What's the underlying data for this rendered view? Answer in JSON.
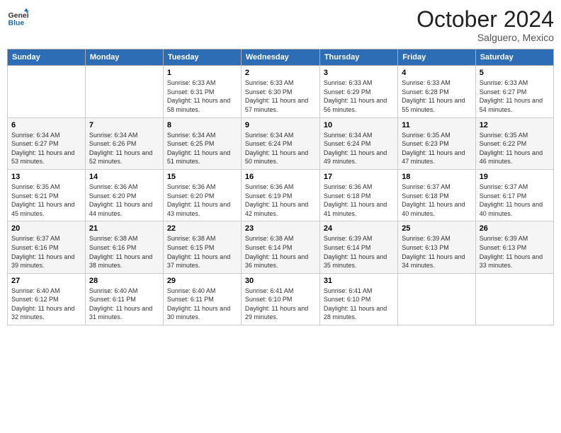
{
  "logo": {
    "line1": "General",
    "line2": "Blue"
  },
  "header": {
    "month": "October 2024",
    "location": "Salguero, Mexico"
  },
  "weekdays": [
    "Sunday",
    "Monday",
    "Tuesday",
    "Wednesday",
    "Thursday",
    "Friday",
    "Saturday"
  ],
  "weeks": [
    [
      {
        "day": "",
        "sunrise": "",
        "sunset": "",
        "daylight": ""
      },
      {
        "day": "",
        "sunrise": "",
        "sunset": "",
        "daylight": ""
      },
      {
        "day": "1",
        "sunrise": "Sunrise: 6:33 AM",
        "sunset": "Sunset: 6:31 PM",
        "daylight": "Daylight: 11 hours and 58 minutes."
      },
      {
        "day": "2",
        "sunrise": "Sunrise: 6:33 AM",
        "sunset": "Sunset: 6:30 PM",
        "daylight": "Daylight: 11 hours and 57 minutes."
      },
      {
        "day": "3",
        "sunrise": "Sunrise: 6:33 AM",
        "sunset": "Sunset: 6:29 PM",
        "daylight": "Daylight: 11 hours and 56 minutes."
      },
      {
        "day": "4",
        "sunrise": "Sunrise: 6:33 AM",
        "sunset": "Sunset: 6:28 PM",
        "daylight": "Daylight: 11 hours and 55 minutes."
      },
      {
        "day": "5",
        "sunrise": "Sunrise: 6:33 AM",
        "sunset": "Sunset: 6:27 PM",
        "daylight": "Daylight: 11 hours and 54 minutes."
      }
    ],
    [
      {
        "day": "6",
        "sunrise": "Sunrise: 6:34 AM",
        "sunset": "Sunset: 6:27 PM",
        "daylight": "Daylight: 11 hours and 53 minutes."
      },
      {
        "day": "7",
        "sunrise": "Sunrise: 6:34 AM",
        "sunset": "Sunset: 6:26 PM",
        "daylight": "Daylight: 11 hours and 52 minutes."
      },
      {
        "day": "8",
        "sunrise": "Sunrise: 6:34 AM",
        "sunset": "Sunset: 6:25 PM",
        "daylight": "Daylight: 11 hours and 51 minutes."
      },
      {
        "day": "9",
        "sunrise": "Sunrise: 6:34 AM",
        "sunset": "Sunset: 6:24 PM",
        "daylight": "Daylight: 11 hours and 50 minutes."
      },
      {
        "day": "10",
        "sunrise": "Sunrise: 6:34 AM",
        "sunset": "Sunset: 6:24 PM",
        "daylight": "Daylight: 11 hours and 49 minutes."
      },
      {
        "day": "11",
        "sunrise": "Sunrise: 6:35 AM",
        "sunset": "Sunset: 6:23 PM",
        "daylight": "Daylight: 11 hours and 47 minutes."
      },
      {
        "day": "12",
        "sunrise": "Sunrise: 6:35 AM",
        "sunset": "Sunset: 6:22 PM",
        "daylight": "Daylight: 11 hours and 46 minutes."
      }
    ],
    [
      {
        "day": "13",
        "sunrise": "Sunrise: 6:35 AM",
        "sunset": "Sunset: 6:21 PM",
        "daylight": "Daylight: 11 hours and 45 minutes."
      },
      {
        "day": "14",
        "sunrise": "Sunrise: 6:36 AM",
        "sunset": "Sunset: 6:20 PM",
        "daylight": "Daylight: 11 hours and 44 minutes."
      },
      {
        "day": "15",
        "sunrise": "Sunrise: 6:36 AM",
        "sunset": "Sunset: 6:20 PM",
        "daylight": "Daylight: 11 hours and 43 minutes."
      },
      {
        "day": "16",
        "sunrise": "Sunrise: 6:36 AM",
        "sunset": "Sunset: 6:19 PM",
        "daylight": "Daylight: 11 hours and 42 minutes."
      },
      {
        "day": "17",
        "sunrise": "Sunrise: 6:36 AM",
        "sunset": "Sunset: 6:18 PM",
        "daylight": "Daylight: 11 hours and 41 minutes."
      },
      {
        "day": "18",
        "sunrise": "Sunrise: 6:37 AM",
        "sunset": "Sunset: 6:18 PM",
        "daylight": "Daylight: 11 hours and 40 minutes."
      },
      {
        "day": "19",
        "sunrise": "Sunrise: 6:37 AM",
        "sunset": "Sunset: 6:17 PM",
        "daylight": "Daylight: 11 hours and 40 minutes."
      }
    ],
    [
      {
        "day": "20",
        "sunrise": "Sunrise: 6:37 AM",
        "sunset": "Sunset: 6:16 PM",
        "daylight": "Daylight: 11 hours and 39 minutes."
      },
      {
        "day": "21",
        "sunrise": "Sunrise: 6:38 AM",
        "sunset": "Sunset: 6:16 PM",
        "daylight": "Daylight: 11 hours and 38 minutes."
      },
      {
        "day": "22",
        "sunrise": "Sunrise: 6:38 AM",
        "sunset": "Sunset: 6:15 PM",
        "daylight": "Daylight: 11 hours and 37 minutes."
      },
      {
        "day": "23",
        "sunrise": "Sunrise: 6:38 AM",
        "sunset": "Sunset: 6:14 PM",
        "daylight": "Daylight: 11 hours and 36 minutes."
      },
      {
        "day": "24",
        "sunrise": "Sunrise: 6:39 AM",
        "sunset": "Sunset: 6:14 PM",
        "daylight": "Daylight: 11 hours and 35 minutes."
      },
      {
        "day": "25",
        "sunrise": "Sunrise: 6:39 AM",
        "sunset": "Sunset: 6:13 PM",
        "daylight": "Daylight: 11 hours and 34 minutes."
      },
      {
        "day": "26",
        "sunrise": "Sunrise: 6:39 AM",
        "sunset": "Sunset: 6:13 PM",
        "daylight": "Daylight: 11 hours and 33 minutes."
      }
    ],
    [
      {
        "day": "27",
        "sunrise": "Sunrise: 6:40 AM",
        "sunset": "Sunset: 6:12 PM",
        "daylight": "Daylight: 11 hours and 32 minutes."
      },
      {
        "day": "28",
        "sunrise": "Sunrise: 6:40 AM",
        "sunset": "Sunset: 6:11 PM",
        "daylight": "Daylight: 11 hours and 31 minutes."
      },
      {
        "day": "29",
        "sunrise": "Sunrise: 6:40 AM",
        "sunset": "Sunset: 6:11 PM",
        "daylight": "Daylight: 11 hours and 30 minutes."
      },
      {
        "day": "30",
        "sunrise": "Sunrise: 6:41 AM",
        "sunset": "Sunset: 6:10 PM",
        "daylight": "Daylight: 11 hours and 29 minutes."
      },
      {
        "day": "31",
        "sunrise": "Sunrise: 6:41 AM",
        "sunset": "Sunset: 6:10 PM",
        "daylight": "Daylight: 11 hours and 28 minutes."
      },
      {
        "day": "",
        "sunrise": "",
        "sunset": "",
        "daylight": ""
      },
      {
        "day": "",
        "sunrise": "",
        "sunset": "",
        "daylight": ""
      }
    ]
  ]
}
